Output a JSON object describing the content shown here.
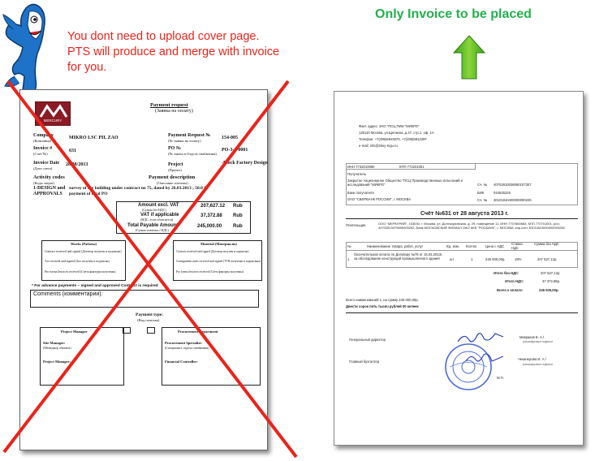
{
  "header": {
    "red_note": [
      "You dont need to upload cover page.",
      "PTS will produce and merge with invoice",
      "for you."
    ],
    "green_title": "Only Invoice to be placed"
  },
  "colors": {
    "red": "#e8241c",
    "green": "#22b14c",
    "logo": "#8b1a24"
  },
  "cover": {
    "logo_text": "MERCURY",
    "title": "Payment request",
    "subtitle": "(Заявка на оплату)",
    "company_label": "Company",
    "company_sub": "(Компания)",
    "company_value": "MIKRO LSC PII, ZAO",
    "invoice_label": "Invoice #",
    "invoice_sub": "(Счет №)",
    "invoice_value": "631",
    "invoice_date_label": "Invoice Date",
    "invoice_date_sub": "(Дата счета)",
    "invoice_date_value": "28/08/2013",
    "pr_label": "Payment Request №",
    "pr_sub": "(№ заявки на оплату)",
    "pr_value": "154-005",
    "po_label": "PO №",
    "po_sub": "(№ заказа в Отдела снабжения)",
    "po_value": "PO-3-1-0001",
    "project_label": "Project",
    "project_sub": "(Проект)",
    "project_value": "-Block Factory Design",
    "activity_label": "Activity codes",
    "activity_sub": "(Коды затрат)",
    "activity_value1": "1-DESIGN and",
    "activity_value2": "APPROVALS",
    "desc_label": "Payment description",
    "desc_sub": "(Описание платежа)",
    "desc_value1": "survey of the building under contract no 75, dated by 26.03.2013 ; 50.0 %",
    "desc_value2": "payment of total PO",
    "amount_label": "Amount excl. VAT",
    "amount_sub": "(Сумма без НДС)",
    "amount_value": "207,627.12",
    "vat_label": "VAT if applicable",
    "vat_sub": "(НДС, если облагается)",
    "vat_value": "37,372.88",
    "total_label": "Total Payable Amount",
    "total_sub": "(Сумма платежа с НДС)",
    "total_value": "245,000.00",
    "currency": "Rub",
    "works_title": "Works (Работы)",
    "material_title": "Material (Материалы)",
    "works_rows": [
      "Contract received and signed (Договор получен и подписан)",
      "Act received and signed (Акт получен и подписан)",
      "Pro forma Invoices received (Счета фактуры получены)"
    ],
    "material_rows": [
      "Contract received and signed (Договор получен и подписан)",
      "Consignment notes received and signed (ТТН получены и подписаны)",
      "Pro forma Invoices received (Счета фактуры получены)"
    ],
    "advance_note": "* For advance payments – signed and approved Contract is required",
    "comments_label": "Comments (комментарии):",
    "payment_type": "Payment type:",
    "payment_type_sub": "(Вид платежа)",
    "pm_title": "Project Manager",
    "pd_title": "Procurement Department",
    "site_manager": "Site Manager:",
    "site_manager_sub": "(Менеджер объекта)",
    "project_manager": "Project Manager:",
    "procurement_specialist": "Procurement Specialist:",
    "procurement_specialist_sub": "(Специалист отдела снабжения)",
    "financial_controller": "Financial Controller:"
  },
  "invoice": {
    "address_line": "Факт. адрес: ЗАО \"ПСЦ ПИИ \"МИКРО\"",
    "address2": "125110 Москва, ул.Щепкина, д.47, стр.1, оф. 1А",
    "phone": "Телефон: +7(495)6843670, +7(495)6814397",
    "email": "e-mail: info@zkoy-mgu.ru",
    "inn": "ИНН 7732010080",
    "kpp": "КПП 773201001",
    "receiver_label": "Получатель",
    "receiver": "Закрытое Акционерное Общество \"ПСЦ Производственных испытаний и исследований \"МИКРО\"",
    "account_label": "Сч. №",
    "account": "40702810038060107307",
    "bank_label": "Банк получателя",
    "bank": "ОАО \"СБЕРБАНК РОССИИ\", г. МОСКВА",
    "bik_label": "БИК",
    "bik": "044525225",
    "corr_label": "Сч. №",
    "corr": "30101810400000000225",
    "title": "Счёт №631 от 28 августа 2013 г.",
    "payer_label": "Плательщик:",
    "payer": "ООО \"МЕРКУРИЙ\", 103030, г. Москва, ул. Долгоруковская, д. 29, помещение 11, ИНН 7707660663, КПП 770701001, р/сч 40702810479600000292, Банк МОСКОВСКИЙ ФИЛИАЛ ОАО АКБ \"РОСБАНК\", г. МОСКВА, кор.счет 30101810000000000256",
    "columns": [
      "№",
      "Наименование товара, работ, услуг",
      "Ед. изм.",
      "Кол-во",
      "Цена с НДС",
      "Ставка НДС",
      "Сумма без НДС"
    ],
    "row": [
      "1",
      "Окончательная оплата по Договору №75 от 15.03.2013г. за обследование конструкций промышленного здания",
      "шт",
      "1",
      "245 000,00р.",
      "18%",
      "207 627,12р."
    ],
    "total_no_vat_label": "Итого без НДС:",
    "total_no_vat": "207 627,12р.",
    "vat_label": "Итого НДС:",
    "vat": "37 372,88р.",
    "grand_label": "Всего к оплате:",
    "grand": "245 000,00р.",
    "sum_line": "Всего наименований 1, на сумму 245 000,00р.",
    "sum_words": "Двести сорок пять тысяч рублей 00 копеек",
    "director_label": "Генеральный директор",
    "director_name": "Микраков Б. А./",
    "accountant_label": "Главный бухгалтер",
    "accountant_name": "Чеканерова И. А./",
    "signature_caption": "расшифровка подписи",
    "mp": "М.П."
  }
}
